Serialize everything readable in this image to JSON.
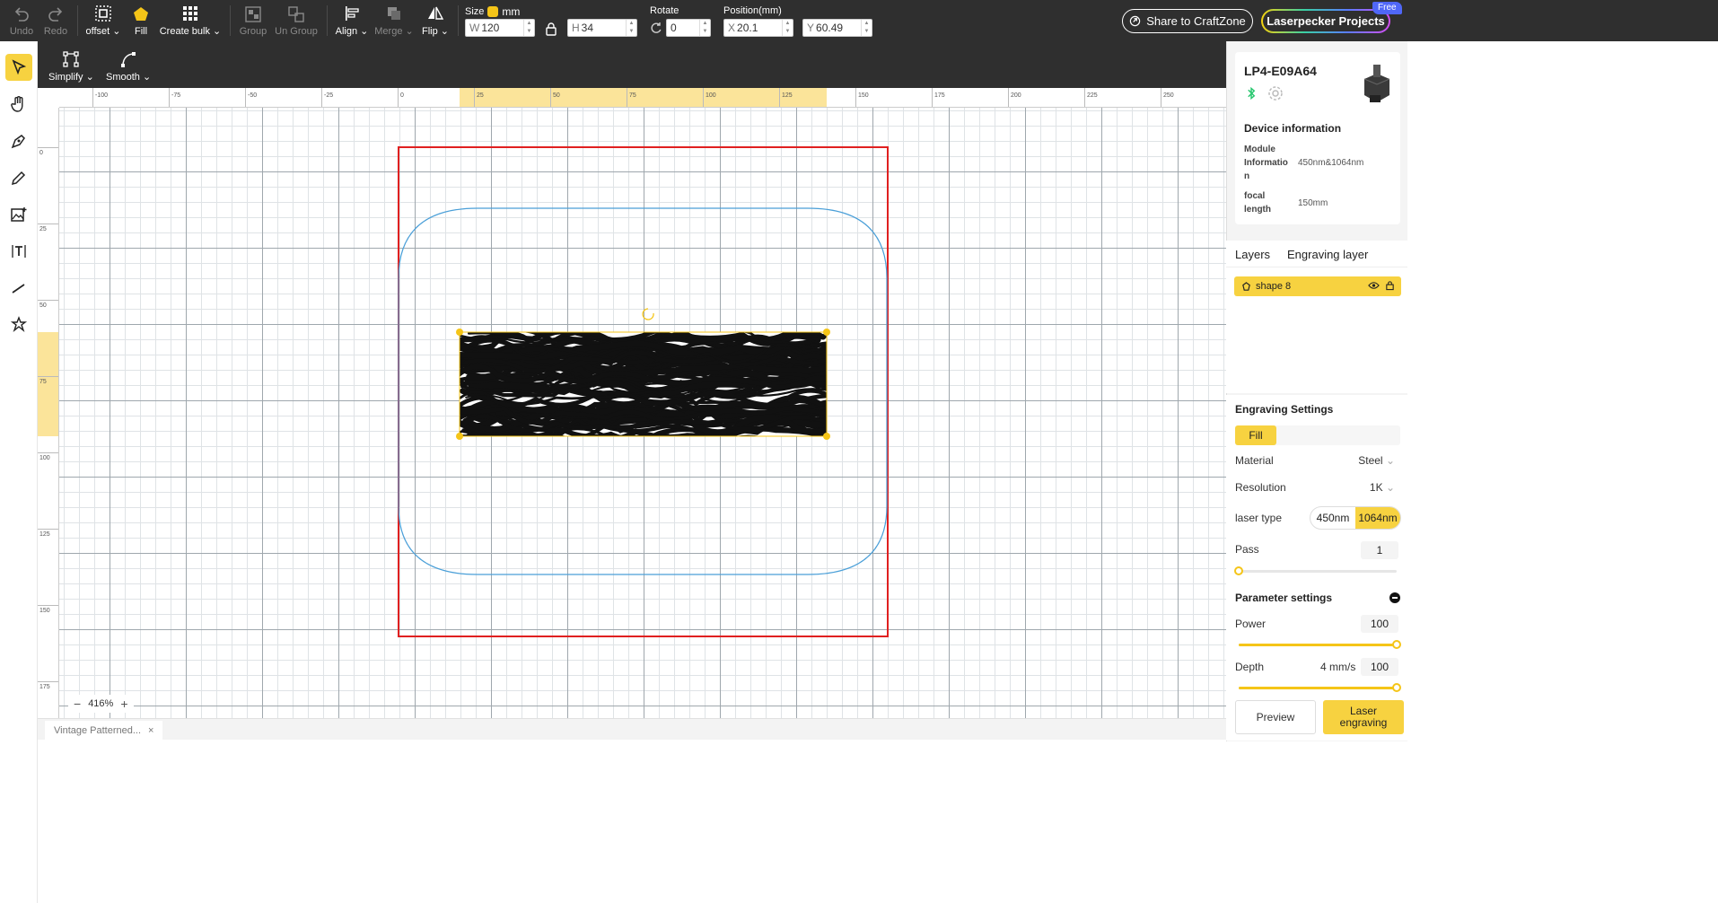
{
  "toolbar": {
    "undo": "Undo",
    "redo": "Redo",
    "offset": "offset",
    "fill": "Fill",
    "create_bulk": "Create bulk",
    "group": "Group",
    "ungroup": "Un Group",
    "align": "Align",
    "merge": "Merge",
    "flip": "Flip",
    "size_label": "Size",
    "unit": "mm",
    "width_prefix": "W",
    "width": "120",
    "height_prefix": "H",
    "height": "34",
    "rotate_label": "Rotate",
    "rotate": "0",
    "position_label": "Position(mm)",
    "x_prefix": "X",
    "x": "20.1",
    "y_prefix": "Y",
    "y": "60.49",
    "share": "Share to CraftZone",
    "projects": "Laserpecker Projects",
    "free_badge": "Free"
  },
  "secondary": {
    "simplify": "Simplify",
    "smooth": "Smooth"
  },
  "ruler": {
    "x_ticks": [
      "-100",
      "-75",
      "-50",
      "-25",
      "0",
      "25",
      "50",
      "75",
      "100",
      "125",
      "150",
      "175",
      "200",
      "225",
      "250"
    ],
    "y_ticks": [
      "0",
      "25",
      "50",
      "75",
      "100",
      "125",
      "150",
      "175"
    ]
  },
  "canvas": {
    "zoom": "416%",
    "file_tab": "Vintage Patterned..."
  },
  "device": {
    "name": "LP4-E09A64",
    "info_title": "Device information",
    "module_label_1": "Module",
    "module_label_2": "Informatio",
    "module_label_3": "n",
    "module_value": "450nm&1064nm",
    "focal_label_1": "focal",
    "focal_label_2": "length",
    "focal_value": "150mm"
  },
  "tabs": {
    "layers": "Layers",
    "engraving_layer": "Engraving layer"
  },
  "layers": [
    {
      "name": "shape 8"
    }
  ],
  "engraving": {
    "title": "Engraving Settings",
    "mode": "Fill",
    "material_label": "Material",
    "material": "Steel",
    "resolution_label": "Resolution",
    "resolution": "1K",
    "laser_type_label": "laser type",
    "laser_450": "450nm",
    "laser_1064": "1064nm",
    "pass_label": "Pass",
    "pass": "1",
    "pass_fraction": 0.0,
    "param_title": "Parameter settings",
    "power_label": "Power",
    "power": "100",
    "power_fraction": 1.0,
    "depth_label": "Depth",
    "depth_speed": "4 mm/s",
    "depth": "100",
    "depth_fraction": 1.0,
    "preview": "Preview",
    "laser_engraving_1": "Laser",
    "laser_engraving_2": "engraving"
  },
  "colors": {
    "accent": "#f7d240",
    "frame": "#e02020",
    "outline": "#4a9fd8",
    "bluetooth": "#28c76f"
  }
}
